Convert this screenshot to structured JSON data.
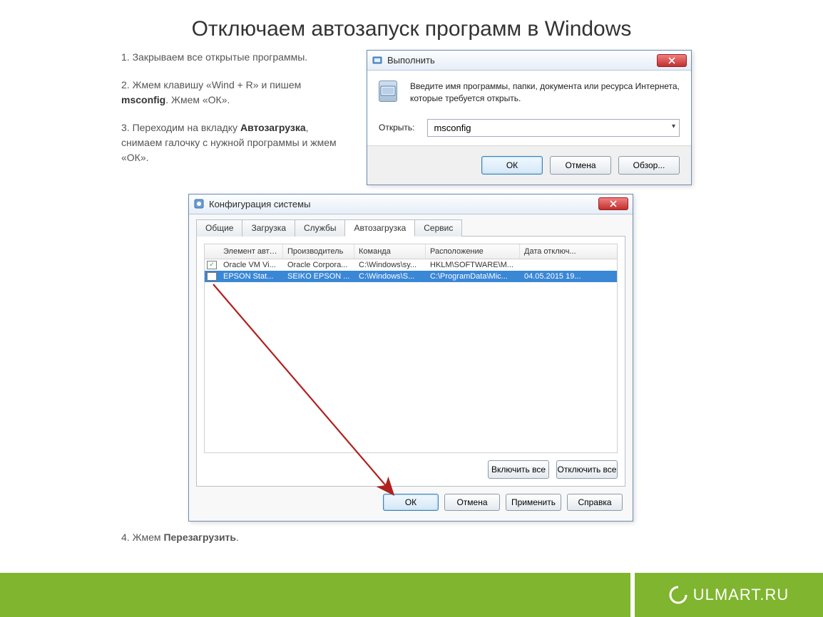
{
  "page": {
    "title": "Отключаем автозапуск программ в Windows"
  },
  "steps": {
    "s1_num": "1. ",
    "s1": "Закрываем все открытые программы.",
    "s2_num": "2. ",
    "s2a": "Жмем клавишу «Wind + R» и пишем ",
    "s2b": "msconfig",
    "s2c": ". Жмем «ОК».",
    "s3_num": "3. ",
    "s3a": "Переходим на вкладку ",
    "s3b": "Автозагрузка",
    "s3c": ", снимаем галочку с нужной программы и жмем «ОК».",
    "s4_num": "4. ",
    "s4a": "Жмем ",
    "s4b": "Перезагрузить",
    "s4c": "."
  },
  "run_dialog": {
    "title": "Выполнить",
    "description": "Введите имя программы, папки, документа или ресурса Интернета, которые требуется открыть.",
    "open_label": "Открыть:",
    "input_value": "msconfig",
    "btn_ok": "ОК",
    "btn_cancel": "Отмена",
    "btn_browse": "Обзор..."
  },
  "msconfig": {
    "title": "Конфигурация системы",
    "tabs": {
      "general": "Общие",
      "boot": "Загрузка",
      "services": "Службы",
      "startup": "Автозагрузка",
      "tools": "Сервис"
    },
    "columns": {
      "item": "Элемент авто...",
      "manufacturer": "Производитель",
      "command": "Команда",
      "location": "Расположение",
      "disabled_date": "Дата отключ..."
    },
    "rows": [
      {
        "checked": true,
        "item": "Oracle VM Vi...",
        "manufacturer": "Oracle Corpora...",
        "command": "C:\\Windows\\sy...",
        "location": "HKLM\\SOFTWARE\\M...",
        "disabled": ""
      },
      {
        "checked": false,
        "item": "EPSON Stat...",
        "manufacturer": "SEIKO EPSON ...",
        "command": "C:\\Windows\\S...",
        "location": "C:\\ProgramData\\Mic...",
        "disabled": "04.05.2015 19..."
      }
    ],
    "btn_enable_all": "Включить все",
    "btn_disable_all": "Отключить все",
    "btn_ok": "ОК",
    "btn_cancel": "Отмена",
    "btn_apply": "Применить",
    "btn_help": "Справка"
  },
  "brand": {
    "text": "ULMART.RU"
  }
}
